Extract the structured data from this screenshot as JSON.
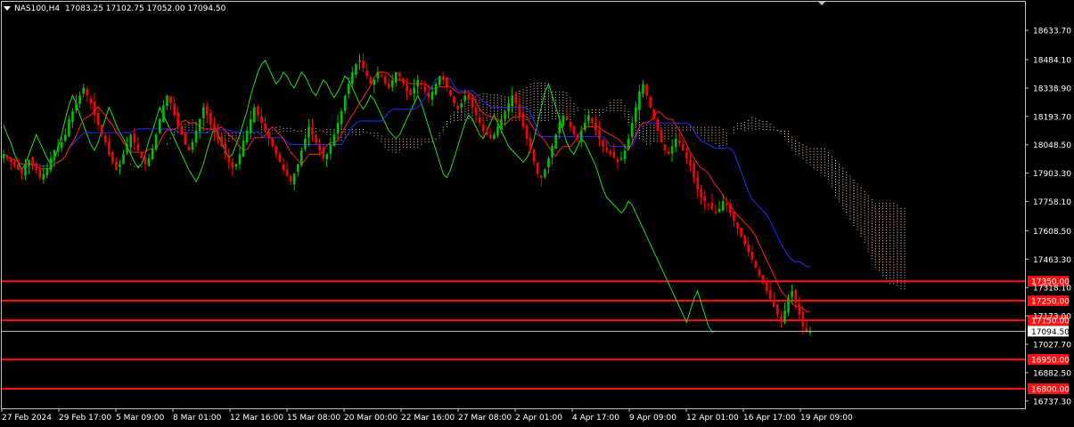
{
  "header": {
    "symbol": "NAS100,H4",
    "ohlc": "17083.25 17102.75 17052.00 17094.50"
  },
  "colors": {
    "background": "#000000",
    "frame": "#c0c0c0",
    "bull": "#00c000",
    "bear": "#ff0000",
    "tenkan": "#ff2020",
    "kijun": "#2030ff",
    "chikou": "#22dd22",
    "cloud": "#ffd0b0",
    "level": "#ff1010",
    "text": "#ffffff"
  },
  "chart_data": {
    "type": "candlestick",
    "symbol": "NAS100",
    "timeframe": "H4",
    "ylim": [
      16700,
      18780
    ],
    "y_ticks": [
      "18633.70",
      "18484.10",
      "18338.90",
      "18193.70",
      "18048.50",
      "17903.30",
      "17758.10",
      "17608.50",
      "17463.30",
      "17318.10",
      "17173.00",
      "17027.70",
      "16882.50",
      "16737.30"
    ],
    "x_ticks": [
      "27 Feb 2024",
      "29 Feb 17:00",
      "5 Mar 09:00",
      "8 Mar 01:00",
      "12 Mar 16:00",
      "15 Mar 08:00",
      "20 Mar 00:00",
      "22 Mar 16:00",
      "27 Mar 08:00",
      "2 Apr 01:00",
      "4 Apr 17:00",
      "9 Apr 09:00",
      "12 Apr 01:00",
      "16 Apr 17:00",
      "19 Apr 09:00"
    ],
    "current_price": "17094.50",
    "levels": [
      {
        "value": 17350,
        "label": "17350.00"
      },
      {
        "value": 17250,
        "label": "17250.00"
      },
      {
        "value": 17150,
        "label": "17150.00"
      },
      {
        "value": 16950,
        "label": "16950.00"
      },
      {
        "value": 16800,
        "label": "16800.00"
      }
    ],
    "closes": [
      18000,
      17980,
      17960,
      17940,
      17920,
      17900,
      17950,
      17970,
      17940,
      17920,
      17880,
      17900,
      17930,
      17980,
      18020,
      18040,
      18060,
      18100,
      18180,
      18220,
      18260,
      18300,
      18340,
      18300,
      18260,
      18200,
      18150,
      18100,
      18060,
      18000,
      17960,
      17920,
      17950,
      18000,
      18050,
      18100,
      18060,
      18020,
      17980,
      17950,
      17980,
      18030,
      18100,
      18180,
      18250,
      18300,
      18260,
      18200,
      18150,
      18100,
      18050,
      18020,
      18060,
      18120,
      18180,
      18240,
      18200,
      18150,
      18110,
      18080,
      18040,
      18000,
      17960,
      17930,
      17950,
      18000,
      18070,
      18120,
      18180,
      18240,
      18200,
      18160,
      18120,
      18080,
      18040,
      18000,
      17960,
      17920,
      17890,
      17860,
      17900,
      17950,
      18020,
      18080,
      18140,
      18100,
      18060,
      18020,
      17980,
      18000,
      18050,
      18100,
      18160,
      18220,
      18300,
      18360,
      18420,
      18460,
      18480,
      18440,
      18400,
      18360,
      18380,
      18420,
      18400,
      18360,
      18340,
      18380,
      18420,
      18400,
      18360,
      18320,
      18300,
      18340,
      18380,
      18360,
      18320,
      18290,
      18320,
      18360,
      18400,
      18380,
      18340,
      18300,
      18260,
      18230,
      18260,
      18300,
      18280,
      18240,
      18200,
      18160,
      18120,
      18100,
      18080,
      18100,
      18140,
      18180,
      18220,
      18260,
      18300,
      18260,
      18200,
      18140,
      18080,
      18020,
      17960,
      17900,
      17880,
      17920,
      17980,
      18040,
      18100,
      18160,
      18200,
      18180,
      18140,
      18100,
      18080,
      18120,
      18160,
      18200,
      18160,
      18120,
      18080,
      18040,
      18020,
      18000,
      17980,
      17960,
      17980,
      18020,
      18080,
      18160,
      18240,
      18320,
      18360,
      18300,
      18240,
      18180,
      18120,
      18060,
      18020,
      18000,
      18040,
      18080,
      18060,
      18020,
      17980,
      17940,
      17880,
      17820,
      17780,
      17760,
      17740,
      17720,
      17700,
      17720,
      17760,
      17740,
      17700,
      17660,
      17620,
      17580,
      17540,
      17500,
      17460,
      17420,
      17380,
      17340,
      17300,
      17260,
      17220,
      17180,
      17140,
      17200,
      17260,
      17300,
      17240,
      17180,
      17120,
      17090,
      17094.5
    ]
  }
}
